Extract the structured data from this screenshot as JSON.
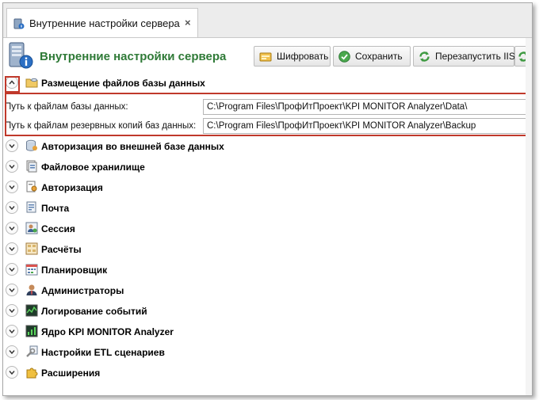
{
  "tab": {
    "title": "Внутренние настройки сервера",
    "close": "×"
  },
  "header": {
    "title": "Внутренние настройки сервера"
  },
  "toolbar": {
    "encrypt_label": "Шифровать",
    "save_label": "Сохранить",
    "restart_label": "Перезапустить IIS"
  },
  "expanded_group": {
    "label": "Размещение файлов базы данных",
    "fields": [
      {
        "label": "Путь к файлам базы данных:",
        "value": "C:\\Program Files\\ПрофИтПроект\\KPI MONITOR Analyzer\\Data\\"
      },
      {
        "label": "Путь к файлам резервных копий баз данных:",
        "value": "C:\\Program Files\\ПрофИтПроект\\KPI MONITOR Analyzer\\Backup"
      }
    ]
  },
  "groups": [
    {
      "label": "Авторизация во внешней базе данных"
    },
    {
      "label": "Файловое хранилище"
    },
    {
      "label": "Авторизация"
    },
    {
      "label": "Почта"
    },
    {
      "label": "Сессия"
    },
    {
      "label": "Расчёты"
    },
    {
      "label": "Планировщик"
    },
    {
      "label": "Администраторы"
    },
    {
      "label": "Логирование событий"
    },
    {
      "label": "Ядро KPI MONITOR Analyzer"
    },
    {
      "label": "Настройки ETL сценариев"
    },
    {
      "label": "Расширения"
    }
  ],
  "colors": {
    "accent_green": "#2f7a37",
    "highlight_red": "#c0392b"
  }
}
